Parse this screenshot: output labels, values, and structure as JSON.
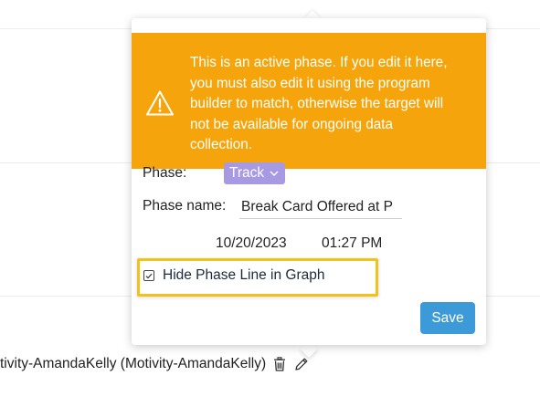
{
  "warning": {
    "icon": "warning-triangle-icon",
    "lines": [
      "This is an active phase. If you edit it here,",
      "you must also edit it using the program",
      "builder to match, otherwise the target will",
      "not be available for ongoing data",
      "collection."
    ],
    "color": "#f5a50b"
  },
  "form": {
    "phase_label": "Phase:",
    "phase_value": "Track",
    "phase_color": "#a79ae2",
    "phase_name_label": "Phase name:",
    "phase_name_value": "Break Card Offered at P",
    "date": "10/20/2023",
    "time": "01:27 PM",
    "hide_phase_label": "Hide Phase Line in Graph",
    "hide_phase_checked": true,
    "save_label": "Save",
    "save_color": "#3d9ad8"
  },
  "background_row": {
    "text": "tivity-AmandaKelly (Motivity-AmandaKelly)",
    "icons": [
      "trash-icon",
      "pencil-icon"
    ]
  }
}
